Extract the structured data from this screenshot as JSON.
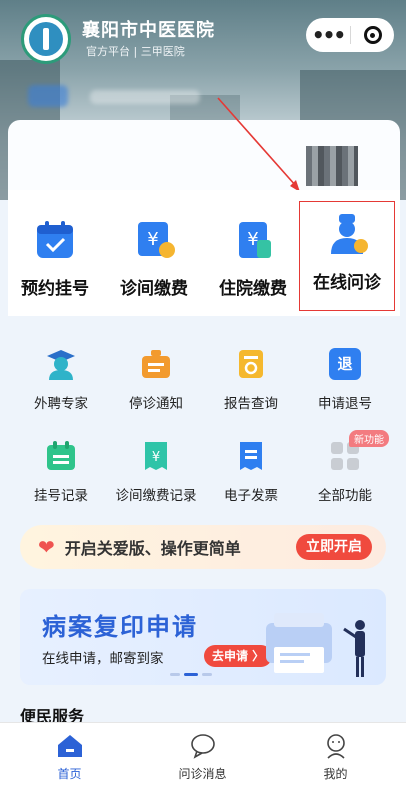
{
  "header": {
    "title": "襄阳市中医医院",
    "subtitle": "官方平台 | 三甲医院"
  },
  "main_services": [
    {
      "label": "预约挂号",
      "icon": "calendar-check-icon"
    },
    {
      "label": "诊间缴费",
      "icon": "yuan-card-icon"
    },
    {
      "label": "住院缴费",
      "icon": "yuan-doc-icon"
    },
    {
      "label": "在线问诊",
      "icon": "doctor-icon"
    }
  ],
  "sub_services": [
    {
      "label": "外聘专家",
      "icon": "expert-icon"
    },
    {
      "label": "停诊通知",
      "icon": "notice-board-icon"
    },
    {
      "label": "报告查询",
      "icon": "report-search-icon"
    },
    {
      "label": "申请退号",
      "icon": "refund-icon",
      "glyph": "退"
    },
    {
      "label": "挂号记录",
      "icon": "register-record-icon"
    },
    {
      "label": "诊间缴费记录",
      "icon": "payment-record-icon"
    },
    {
      "label": "电子发票",
      "icon": "invoice-icon"
    },
    {
      "label": "全部功能",
      "icon": "grid-icon"
    }
  ],
  "new_badge": "新功能",
  "care_banner": {
    "text": "开启关爱版、操作更简单",
    "button": "立即开启"
  },
  "record_banner": {
    "title": "病案复印申请",
    "subtitle": "在线申请，邮寄到家",
    "button": "去申请 〉"
  },
  "section_title": "便民服务",
  "tabs": [
    {
      "label": "首页",
      "icon": "home-icon"
    },
    {
      "label": "问诊消息",
      "icon": "chat-icon"
    },
    {
      "label": "我的",
      "icon": "user-icon"
    }
  ],
  "colors": {
    "accent": "#2c62d6",
    "primary_blue": "#2f7ff0",
    "highlight": "#e53935",
    "button_red": "#f04a3e"
  }
}
